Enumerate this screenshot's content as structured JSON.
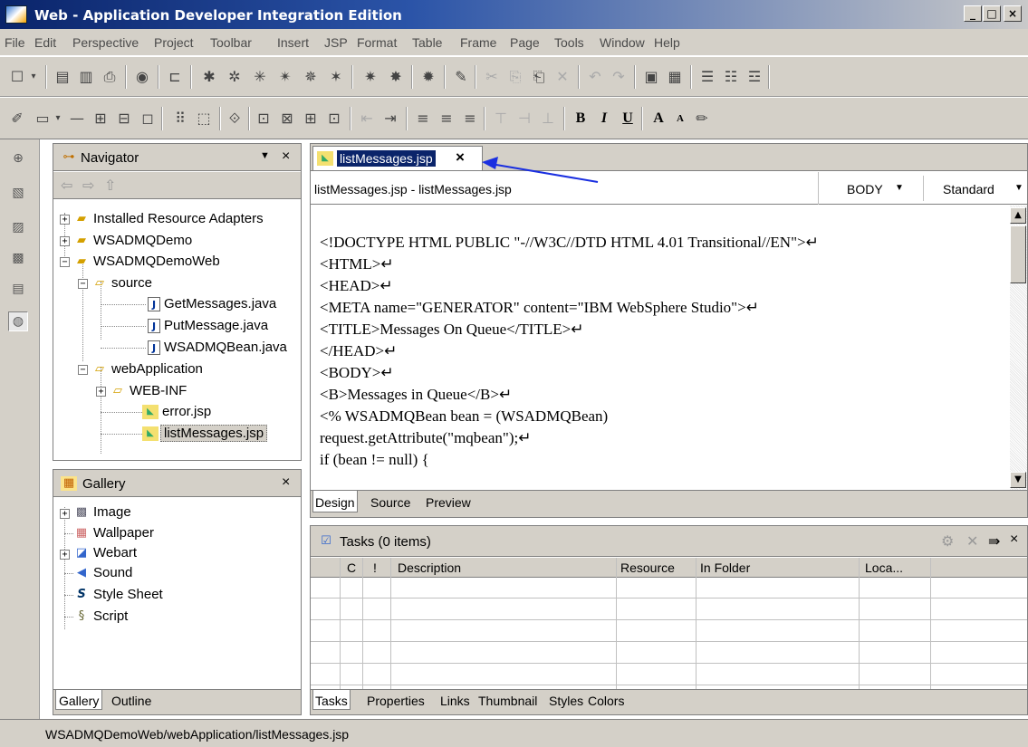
{
  "window": {
    "title": "Web - Application Developer Integration Edition",
    "minimize": "_",
    "maximize": "□",
    "close": "×"
  },
  "menu": [
    "File",
    "Edit",
    "Perspective",
    "Project",
    "Toolbar",
    "Insert",
    "JSP",
    "Format",
    "Table",
    "Frame",
    "Page",
    "Tools",
    "Window",
    "Help"
  ],
  "toolbar2": {
    "bold": "B",
    "italic": "I",
    "underline": "U",
    "font_up": "A",
    "font_down": "A"
  },
  "navigator": {
    "title": "Navigator",
    "back": "⇦",
    "forward": "⇨",
    "up": "⇧",
    "tree": [
      {
        "label": "Installed Resource Adapters"
      },
      {
        "label": "WSADMQDemo"
      },
      {
        "label": "WSADMQDemoWeb"
      },
      {
        "label": "source"
      },
      {
        "label": "GetMessages.java"
      },
      {
        "label": "PutMessage.java"
      },
      {
        "label": "WSADMQBean.java"
      },
      {
        "label": "webApplication"
      },
      {
        "label": "WEB-INF"
      },
      {
        "label": "error.jsp"
      },
      {
        "label": "listMessages.jsp"
      }
    ]
  },
  "gallery": {
    "title": "Gallery",
    "items": [
      "Image",
      "Wallpaper",
      "Webart",
      "Sound",
      "Style Sheet",
      "Script"
    ],
    "tabs": [
      "Gallery",
      "Outline"
    ]
  },
  "editor": {
    "tab": "listMessages.jsp",
    "breadcrumb": "listMessages.jsp - listMessages.jsp",
    "body_select": "BODY",
    "mode_select": "Standard",
    "lines": [
      "<!DOCTYPE HTML PUBLIC \"-//W3C//DTD HTML 4.01 Transitional//EN\">↵",
      "<HTML>↵",
      "<HEAD>↵",
      "<META name=\"GENERATOR\" content=\"IBM WebSphere Studio\">↵",
      "<TITLE>Messages On Queue</TITLE>↵",
      "</HEAD>↵",
      "<BODY>↵",
      "<B>Messages in Queue</B>↵",
      "<% WSADMQBean bean = (WSADMQBean)",
      "request.getAttribute(\"mqbean\");↵",
      "if (bean != null) {"
    ],
    "tabs": [
      "Design",
      "Source",
      "Preview"
    ]
  },
  "tasks": {
    "title": "Tasks (0 items)",
    "columns": [
      "C",
      "!",
      "Description",
      "Resource",
      "In Folder",
      "Loca..."
    ],
    "tabs": [
      "Tasks",
      "Properties",
      "Links",
      "Thumbnail",
      "Styles",
      "Colors"
    ]
  },
  "status": "WSADMQDemoWeb/webApplication/listMessages.jsp",
  "colors": {
    "annotation_arrow": "#1a2fe0",
    "title_active": "#0a246a"
  }
}
